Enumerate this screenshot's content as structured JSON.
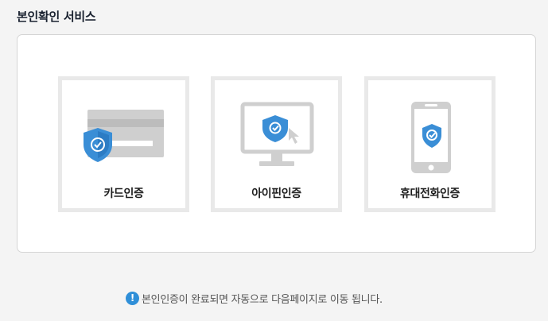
{
  "section": {
    "title": "본인확인 서비스"
  },
  "methods": [
    {
      "label": "카드인증",
      "icon": "credit-card-shield-icon"
    },
    {
      "label": "아이핀인증",
      "icon": "monitor-shield-cursor-icon"
    },
    {
      "label": "휴대전화인증",
      "icon": "mobile-phone-shield-icon"
    }
  ],
  "notice": {
    "icon": "exclamation-icon",
    "icon_glyph": "!",
    "text": "본인인증이 완료되면 자동으로 다음페이지로 이동 됩니다."
  },
  "colors": {
    "accent": "#2f8fd8",
    "shield": "#3a8ed6",
    "illustration_gray": "#cfcfcf",
    "card_border": "#e9e9e9",
    "page_background": "#f4f4f4"
  }
}
